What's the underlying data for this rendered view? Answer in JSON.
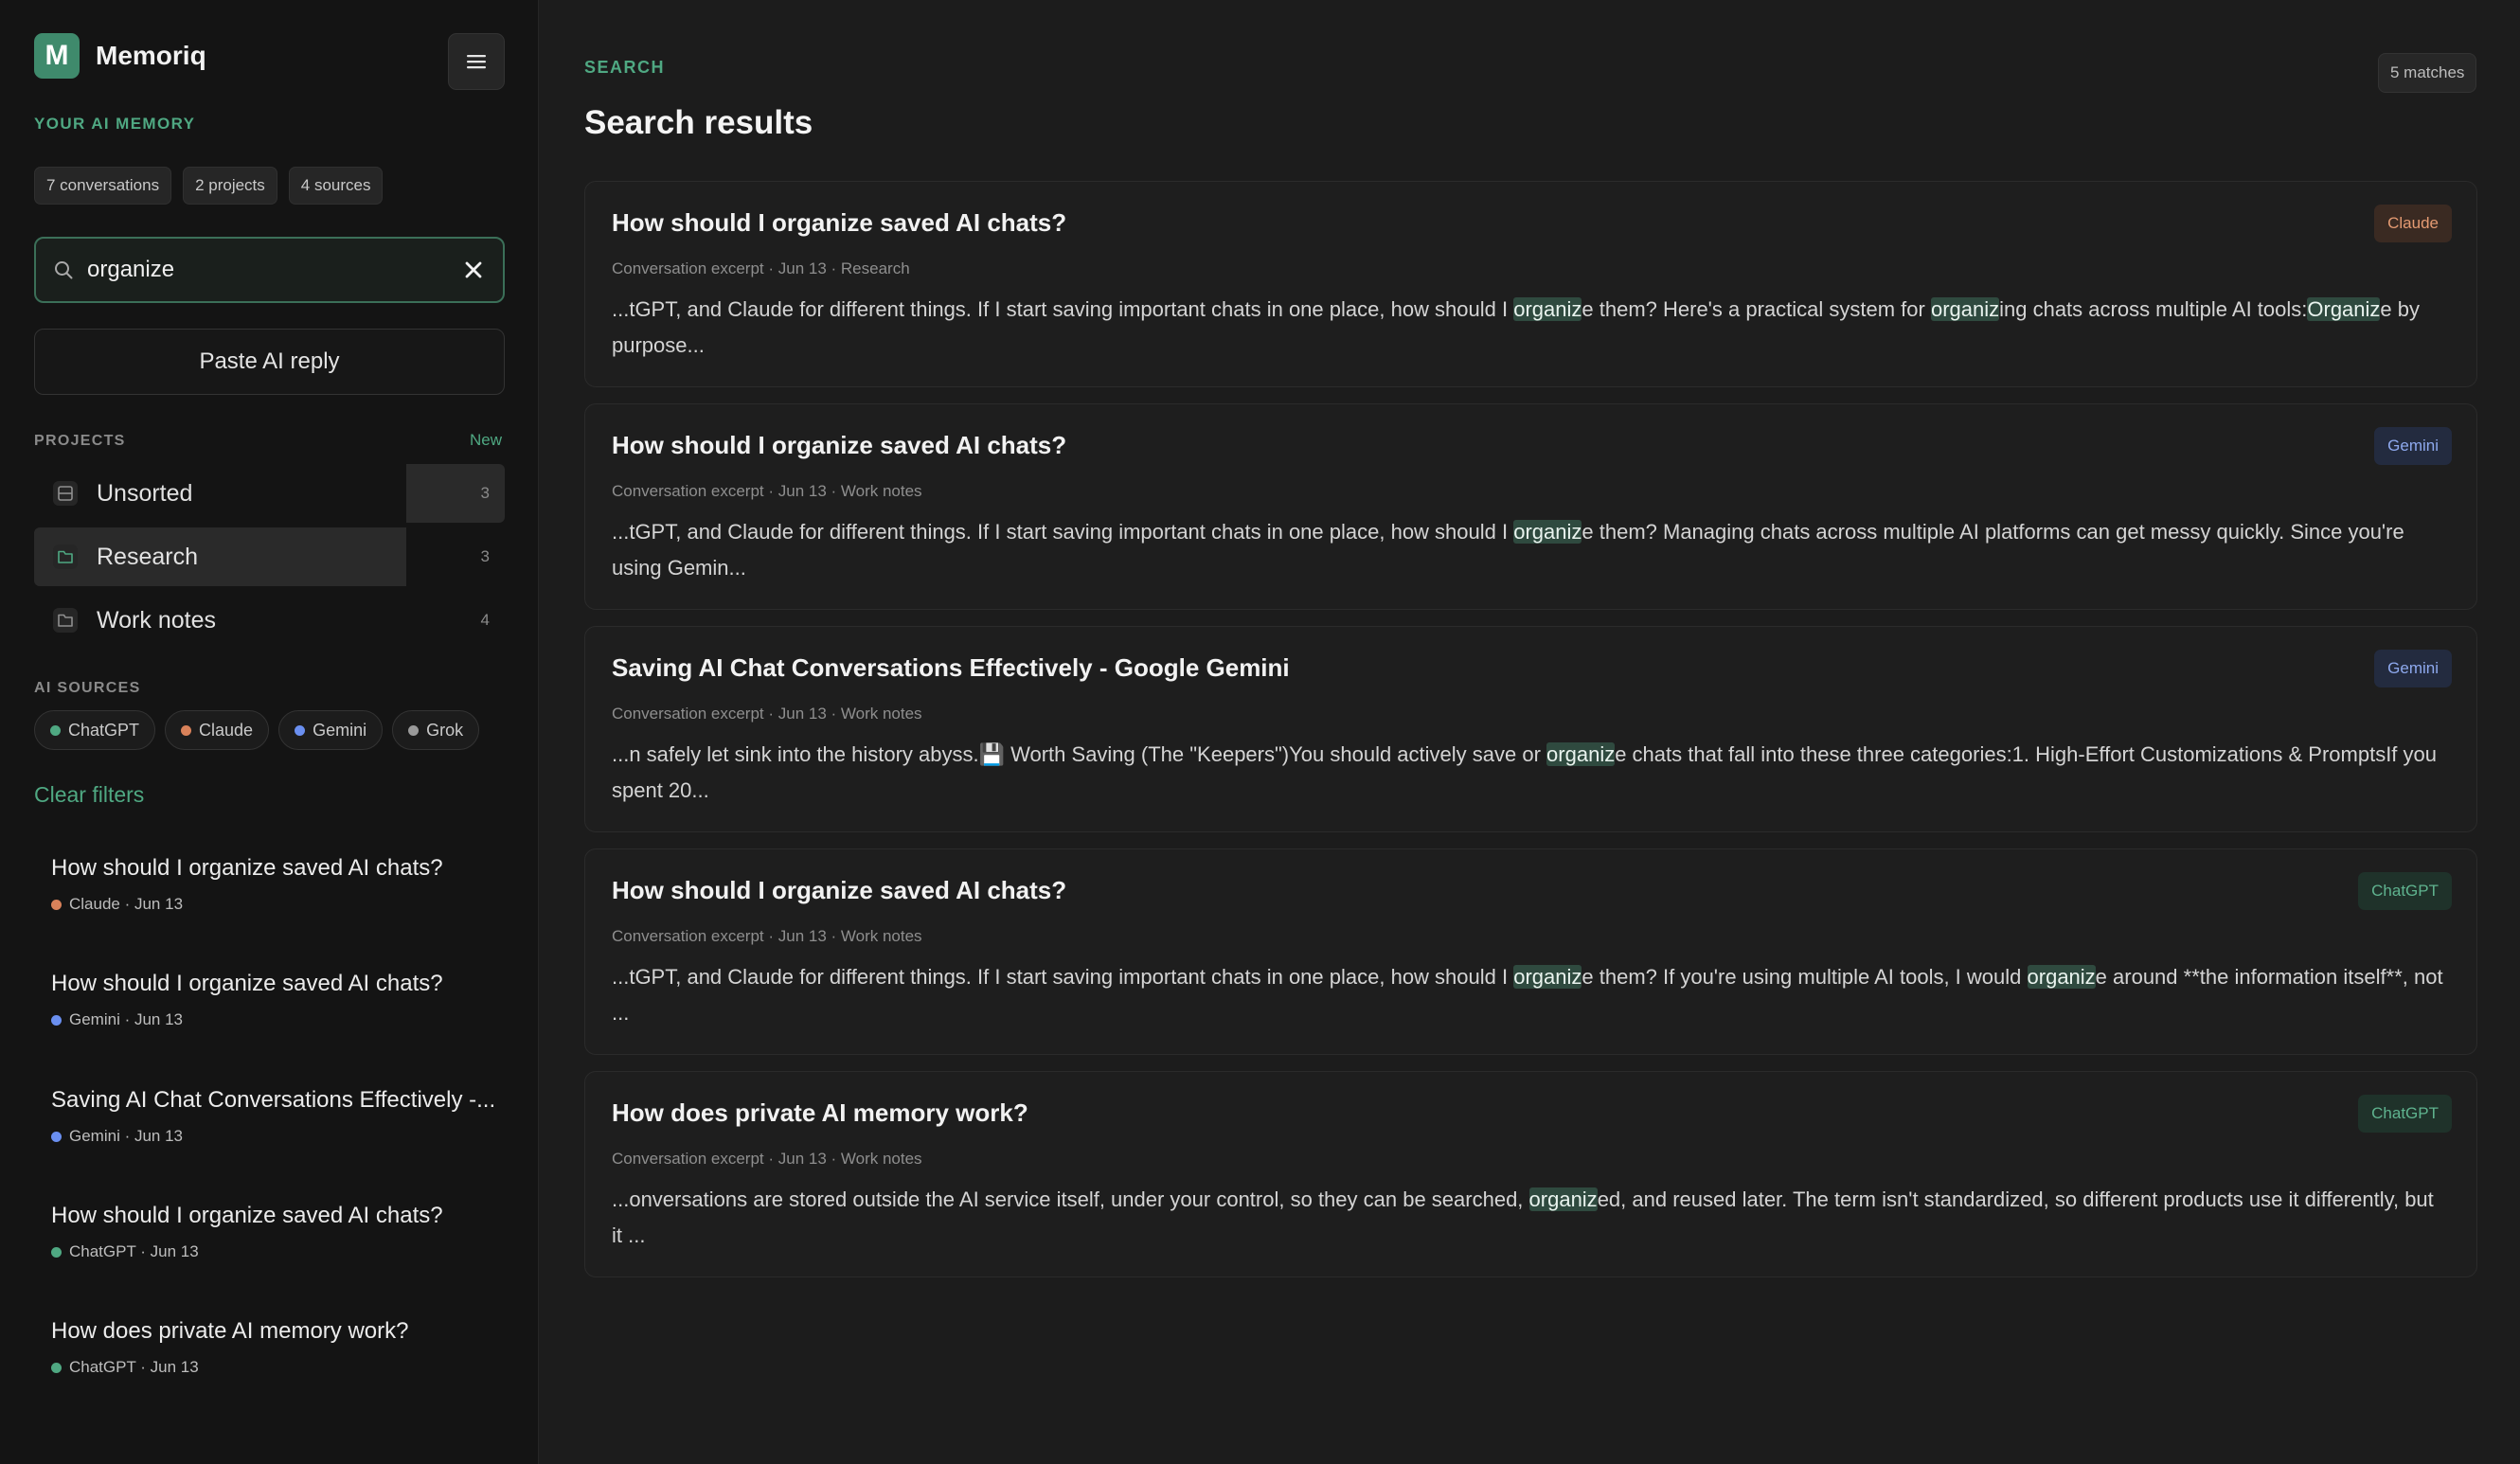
{
  "brand": {
    "logo_letter": "M",
    "name": "Memoriq",
    "tagline": "YOUR AI MEMORY"
  },
  "stats": [
    "7 conversations",
    "2 projects",
    "4 sources"
  ],
  "search": {
    "value": "organize",
    "placeholder": ""
  },
  "paste_label": "Paste AI reply",
  "projects": {
    "label": "PROJECTS",
    "new_label": "New",
    "items": [
      {
        "label": "Unsorted",
        "count": "3"
      },
      {
        "label": "Research",
        "count": "3"
      },
      {
        "label": "Work notes",
        "count": "4"
      }
    ]
  },
  "ai_sources": {
    "label": "AI SOURCES",
    "items": [
      {
        "label": "ChatGPT",
        "color": "#4fa882"
      },
      {
        "label": "Claude",
        "color": "#d9825a"
      },
      {
        "label": "Gemini",
        "color": "#6a8ff0"
      },
      {
        "label": "Grok",
        "color": "#9a9a9a"
      }
    ]
  },
  "clear_filters_label": "Clear filters",
  "conversations": [
    {
      "title": "How should I organize saved AI chats?",
      "meta": "Claude · Jun 13",
      "color": "#d9825a"
    },
    {
      "title": "How should I organize saved AI chats?",
      "meta": "Gemini · Jun 13",
      "color": "#6a8ff0"
    },
    {
      "title": "Saving AI Chat Conversations Effectively -...",
      "meta": "Gemini · Jun 13",
      "color": "#6a8ff0"
    },
    {
      "title": "How should I organize saved AI chats?",
      "meta": "ChatGPT · Jun 13",
      "color": "#4fa882"
    },
    {
      "title": "How does private AI memory work?",
      "meta": "ChatGPT · Jun 13",
      "color": "#4fa882"
    }
  ],
  "main": {
    "crumb": "SEARCH",
    "title": "Search results",
    "matches": "5 matches",
    "results": [
      {
        "title": "How should I organize saved AI chats?",
        "meta": "Conversation excerpt · Jun 13 · Research",
        "source": "Claude",
        "badge": "claude",
        "snippet": [
          {
            "t": "...tGPT, and Claude for different things. If I start saving important chats in one place, how should I "
          },
          {
            "t": "organiz",
            "hl": true
          },
          {
            "t": "e them? Here's a practical system for "
          },
          {
            "t": "organiz",
            "hl": true
          },
          {
            "t": "ing chats across multiple AI tools:"
          },
          {
            "t": "Organiz",
            "hl": true
          },
          {
            "t": "e by purpose..."
          }
        ]
      },
      {
        "title": "How should I organize saved AI chats?",
        "meta": "Conversation excerpt · Jun 13 · Work notes",
        "source": "Gemini",
        "badge": "gemini",
        "snippet": [
          {
            "t": "...tGPT, and Claude for different things. If I start saving important chats in one place, how should I "
          },
          {
            "t": "organiz",
            "hl": true
          },
          {
            "t": "e them? Managing chats across multiple AI platforms can get messy quickly. Since you're using Gemin..."
          }
        ]
      },
      {
        "title": "Saving AI Chat Conversations Effectively - Google Gemini",
        "meta": "Conversation excerpt · Jun 13 · Work notes",
        "source": "Gemini",
        "badge": "gemini",
        "snippet": [
          {
            "t": "...n safely let sink into the history abyss.💾 Worth Saving (The \"Keepers\")You should actively save or "
          },
          {
            "t": "organiz",
            "hl": true
          },
          {
            "t": "e chats that fall into these three categories:1. High-Effort Customizations & PromptsIf you spent 20..."
          }
        ]
      },
      {
        "title": "How should I organize saved AI chats?",
        "meta": "Conversation excerpt · Jun 13 · Work notes",
        "source": "ChatGPT",
        "badge": "chatgpt",
        "snippet": [
          {
            "t": "...tGPT, and Claude for different things. If I start saving important chats in one place, how should I "
          },
          {
            "t": "organiz",
            "hl": true
          },
          {
            "t": "e them? If you're using multiple AI tools, I would "
          },
          {
            "t": "organiz",
            "hl": true
          },
          {
            "t": "e around **the information itself**, not ..."
          }
        ]
      },
      {
        "title": "How does private AI memory work?",
        "meta": "Conversation excerpt · Jun 13 · Work notes",
        "source": "ChatGPT",
        "badge": "chatgpt",
        "snippet": [
          {
            "t": "...onversations are stored outside the AI service itself, under your control, so they can be searched, "
          },
          {
            "t": "organiz",
            "hl": true
          },
          {
            "t": "ed, and reused later. The term isn't standardized, so different products use it differently, but it ..."
          }
        ]
      }
    ]
  }
}
